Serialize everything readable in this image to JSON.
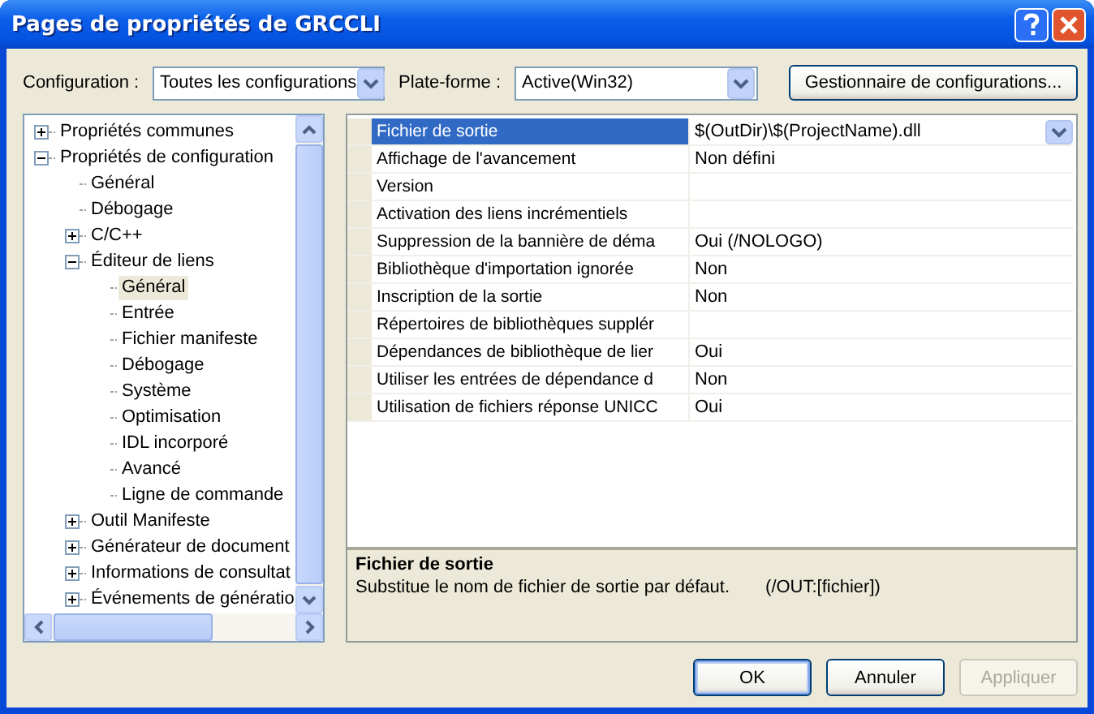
{
  "window": {
    "title": "Pages de propriétés de GRCCLI"
  },
  "toolbar": {
    "configuration_label": "Configuration :",
    "configuration_value": "Toutes les configurations",
    "platform_label": "Plate-forme :",
    "platform_value": "Active(Win32)",
    "manager_button": "Gestionnaire de configurations..."
  },
  "tree": [
    {
      "label": "Propriétés communes",
      "expanded": false,
      "selected": false
    },
    {
      "label": "Propriétés de configuration",
      "expanded": true,
      "selected": false,
      "children": [
        {
          "label": "Général",
          "selected": false
        },
        {
          "label": "Débogage",
          "selected": false
        },
        {
          "label": "C/C++",
          "expanded": false,
          "selected": false
        },
        {
          "label": "Éditeur de liens",
          "expanded": true,
          "selected": false,
          "children": [
            {
              "label": "Général",
              "selected": true
            },
            {
              "label": "Entrée",
              "selected": false
            },
            {
              "label": "Fichier manifeste",
              "selected": false
            },
            {
              "label": "Débogage",
              "selected": false
            },
            {
              "label": "Système",
              "selected": false
            },
            {
              "label": "Optimisation",
              "selected": false
            },
            {
              "label": "IDL incorporé",
              "selected": false
            },
            {
              "label": "Avancé",
              "selected": false
            },
            {
              "label": "Ligne de commande",
              "selected": false
            }
          ]
        },
        {
          "label": "Outil Manifeste",
          "expanded": false,
          "selected": false
        },
        {
          "label": "Générateur de document",
          "expanded": false,
          "selected": false
        },
        {
          "label": "Informations de consultat",
          "expanded": false,
          "selected": false
        },
        {
          "label": "Événements de génératio",
          "expanded": false,
          "selected": false
        }
      ]
    }
  ],
  "properties": [
    {
      "name": "Fichier de sortie",
      "value": "$(OutDir)\\$(ProjectName).dll",
      "selected": true
    },
    {
      "name": "Affichage de l'avancement",
      "value": "Non défini",
      "selected": false
    },
    {
      "name": "Version",
      "selected": false
    },
    {
      "name": "Activation des liens incrémentiels",
      "selected": false
    },
    {
      "name": "Suppression de la bannière de déma",
      "value": "Oui (/NOLOGO)",
      "selected": false
    },
    {
      "name": "Bibliothèque d'importation ignorée",
      "value": "Non",
      "selected": false
    },
    {
      "name": "Inscription de la sortie",
      "value": "Non",
      "selected": false
    },
    {
      "name": "Répertoires de bibliothèques supplér",
      "selected": false
    },
    {
      "name": "Dépendances de bibliothèque de lier",
      "value": "Oui",
      "selected": false
    },
    {
      "name": "Utiliser les entrées de dépendance d",
      "value": "Non",
      "selected": false
    },
    {
      "name": "Utilisation de fichiers réponse UNICC",
      "value": "Oui",
      "selected": false
    }
  ],
  "description": {
    "title": "Fichier de sortie",
    "text": "Substitue le nom de fichier de sortie par défaut.",
    "switch": "(/OUT:[fichier])"
  },
  "buttons": [
    {
      "label": "OK",
      "kind": "default",
      "disabled": false
    },
    {
      "label": "Annuler",
      "kind": "normal",
      "disabled": false
    },
    {
      "label": "Appliquer",
      "kind": "normal",
      "disabled": true
    }
  ]
}
